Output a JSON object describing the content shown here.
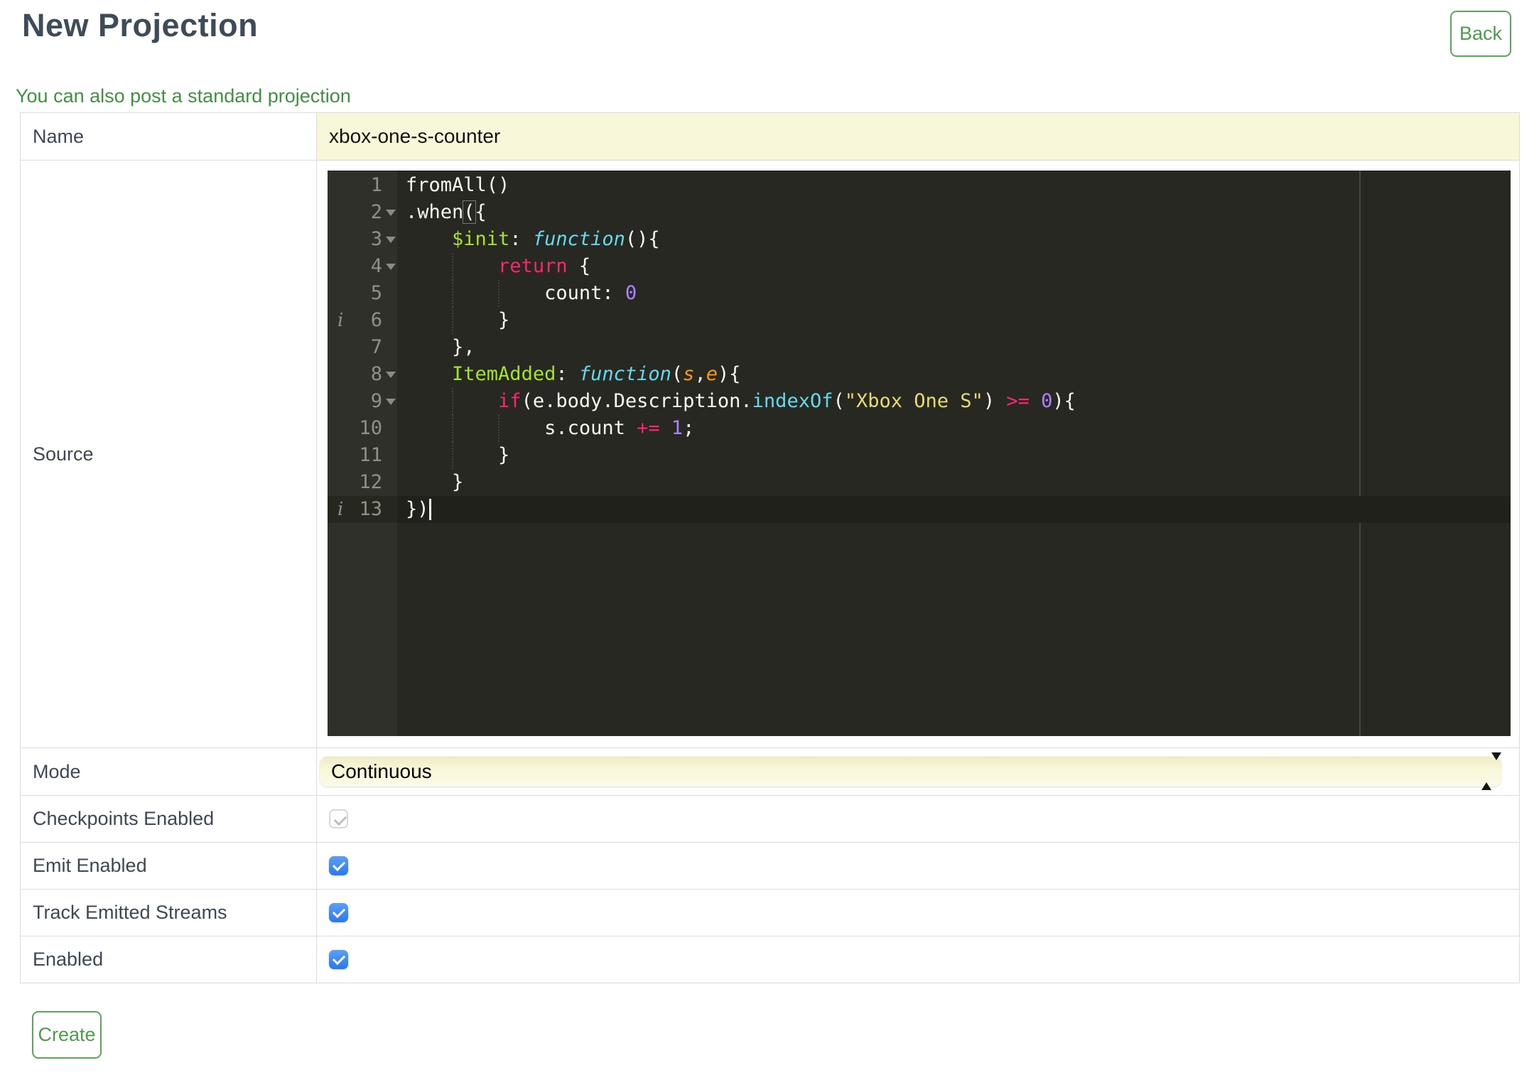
{
  "header": {
    "title": "New Projection",
    "back_label": "Back",
    "link_text": "You can also post a standard projection"
  },
  "form": {
    "labels": [
      "Name",
      "Source",
      "Mode",
      "Checkpoints Enabled",
      "Emit Enabled",
      "Track Emitted Streams",
      "Enabled"
    ],
    "name_value": "xbox-one-s-counter",
    "mode_value": "Continuous",
    "checkboxes": [
      {
        "checked": true,
        "disabled": true
      },
      {
        "checked": true,
        "disabled": false
      },
      {
        "checked": true,
        "disabled": false
      },
      {
        "checked": true,
        "disabled": false
      }
    ]
  },
  "actions": {
    "create_label": "Create"
  },
  "colors": {
    "accent_green": "#4c9d4b",
    "title_text": "#3e4b58",
    "autofill_yellow": "#f9f7d9",
    "checkbox_blue": "#2b77f2",
    "editor_background": "#272822"
  },
  "editor": {
    "language": "javascript",
    "theme": "monokai",
    "token_colors": {
      "w": "#f8f8f2",
      "g": "#a6e22e",
      "c": "#66d9ef",
      "cu": "#66d9ef",
      "p": "#f92672",
      "o": "#fd971f",
      "y": "#e6db74",
      "v": "#ae81ff"
    },
    "italic_tokens": [
      "c",
      "o"
    ],
    "lines": [
      {
        "n": 1,
        "seg": [
          {
            "t": "fromAll()",
            "c": "w"
          }
        ]
      },
      {
        "n": 2,
        "fold": true,
        "seg": [
          {
            "t": ".when",
            "c": "w"
          },
          {
            "t": "(",
            "c": "w",
            "bracket": true
          },
          {
            "t": "{",
            "c": "w"
          }
        ]
      },
      {
        "n": 3,
        "fold": true,
        "seg": [
          {
            "t": "    ",
            "c": "w"
          },
          {
            "t": "$init",
            "c": "g"
          },
          {
            "t": ": ",
            "c": "w"
          },
          {
            "t": "function",
            "c": "c"
          },
          {
            "t": "(){",
            "c": "w"
          }
        ]
      },
      {
        "n": 4,
        "fold": true,
        "guides": [
          4
        ],
        "seg": [
          {
            "t": "        ",
            "c": "w"
          },
          {
            "t": "return",
            "c": "p"
          },
          {
            "t": " {",
            "c": "w"
          }
        ]
      },
      {
        "n": 5,
        "guides": [
          4,
          8
        ],
        "seg": [
          {
            "t": "            count: ",
            "c": "w"
          },
          {
            "t": "0",
            "c": "v"
          }
        ]
      },
      {
        "n": 6,
        "ann": true,
        "guides": [
          4
        ],
        "seg": [
          {
            "t": "        }",
            "c": "w"
          }
        ]
      },
      {
        "n": 7,
        "seg": [
          {
            "t": "    },",
            "c": "w"
          }
        ]
      },
      {
        "n": 8,
        "fold": true,
        "seg": [
          {
            "t": "    ",
            "c": "w"
          },
          {
            "t": "ItemAdded",
            "c": "g"
          },
          {
            "t": ": ",
            "c": "w"
          },
          {
            "t": "function",
            "c": "c"
          },
          {
            "t": "(",
            "c": "w"
          },
          {
            "t": "s",
            "c": "o"
          },
          {
            "t": ",",
            "c": "w"
          },
          {
            "t": "e",
            "c": "o"
          },
          {
            "t": "){",
            "c": "w"
          }
        ]
      },
      {
        "n": 9,
        "fold": true,
        "guides": [
          4
        ],
        "seg": [
          {
            "t": "        ",
            "c": "w"
          },
          {
            "t": "if",
            "c": "p"
          },
          {
            "t": "(e.body.Description.",
            "c": "w"
          },
          {
            "t": "indexOf",
            "c": "cu"
          },
          {
            "t": "(",
            "c": "w"
          },
          {
            "t": "\"Xbox One S\"",
            "c": "y"
          },
          {
            "t": ") ",
            "c": "w"
          },
          {
            "t": ">=",
            "c": "p"
          },
          {
            "t": " ",
            "c": "w"
          },
          {
            "t": "0",
            "c": "v"
          },
          {
            "t": "){",
            "c": "w"
          }
        ]
      },
      {
        "n": 10,
        "guides": [
          4,
          8
        ],
        "seg": [
          {
            "t": "            s.count ",
            "c": "w"
          },
          {
            "t": "+=",
            "c": "p"
          },
          {
            "t": " ",
            "c": "w"
          },
          {
            "t": "1",
            "c": "v"
          },
          {
            "t": ";",
            "c": "w"
          }
        ]
      },
      {
        "n": 11,
        "guides": [
          4
        ],
        "seg": [
          {
            "t": "        }",
            "c": "w"
          }
        ]
      },
      {
        "n": 12,
        "seg": [
          {
            "t": "    }",
            "c": "w"
          }
        ]
      },
      {
        "n": 13,
        "ann": true,
        "active": true,
        "cursor": true,
        "seg": [
          {
            "t": "})",
            "c": "w"
          }
        ]
      }
    ]
  }
}
